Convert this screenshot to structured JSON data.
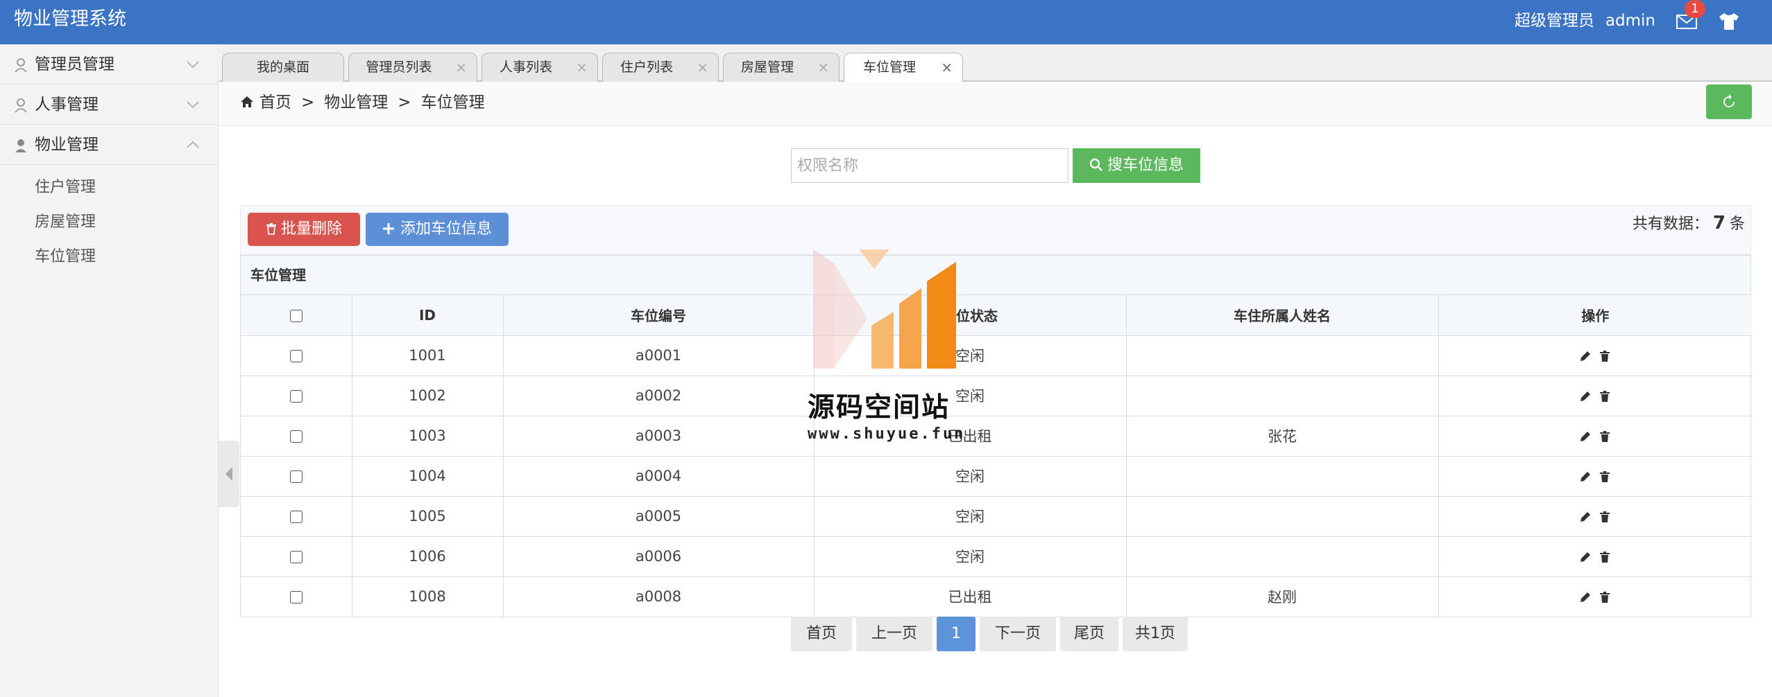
{
  "app": {
    "title": "物业管理系统"
  },
  "header": {
    "role": "超级管理员",
    "username": "admin",
    "mail_badge": "1"
  },
  "sidebar": {
    "groups": [
      {
        "label": "管理员管理",
        "expanded": false
      },
      {
        "label": "人事管理",
        "expanded": false
      },
      {
        "label": "物业管理",
        "expanded": true
      }
    ],
    "sub_items": [
      "住户管理",
      "房屋管理",
      "车位管理"
    ]
  },
  "tabs": [
    {
      "label": "我的桌面",
      "closable": false
    },
    {
      "label": "管理员列表",
      "closable": true
    },
    {
      "label": "人事列表",
      "closable": true
    },
    {
      "label": "住户列表",
      "closable": true
    },
    {
      "label": "房屋管理",
      "closable": true
    },
    {
      "label": "车位管理",
      "closable": true,
      "active": true
    }
  ],
  "breadcrumb": {
    "home": "首页",
    "level1": "物业管理",
    "level2": "车位管理",
    "separator": ">"
  },
  "search": {
    "placeholder": "权限名称",
    "value": "",
    "button_label": "搜车位信息"
  },
  "toolbar": {
    "delete_label": "批量删除",
    "add_label": "添加车位信息",
    "count_prefix": "共有数据：",
    "count_value": "7",
    "count_suffix": "条"
  },
  "table": {
    "panel_title": "车位管理",
    "columns": [
      "ID",
      "车位编号",
      "车位状态",
      "车住所属人姓名",
      "操作"
    ],
    "rows": [
      {
        "id": "1001",
        "code": "a0001",
        "status": "空闲",
        "owner": ""
      },
      {
        "id": "1002",
        "code": "a0002",
        "status": "空闲",
        "owner": ""
      },
      {
        "id": "1003",
        "code": "a0003",
        "status": "已出租",
        "owner": "张花"
      },
      {
        "id": "1004",
        "code": "a0004",
        "status": "空闲",
        "owner": ""
      },
      {
        "id": "1005",
        "code": "a0005",
        "status": "空闲",
        "owner": ""
      },
      {
        "id": "1006",
        "code": "a0006",
        "status": "空闲",
        "owner": ""
      },
      {
        "id": "1008",
        "code": "a0008",
        "status": "已出租",
        "owner": "赵刚"
      }
    ]
  },
  "pagination": {
    "first": "首页",
    "prev": "上一页",
    "current": "1",
    "next": "下一页",
    "last": "尾页",
    "total": "共1页"
  },
  "watermark": {
    "title": "源码空间站",
    "url": "www.shuyue.fun"
  },
  "colors": {
    "header": "#3b73c5",
    "success": "#5cb85c",
    "danger": "#d9534f",
    "primary": "#5c8fd6",
    "badge": "#e64a40"
  },
  "icons": {
    "mail": "mail-icon",
    "theme": "shirt-icon",
    "home": "home-icon",
    "refresh": "refresh-icon",
    "search": "search-icon",
    "trash": "trash-icon",
    "plus": "plus-icon",
    "edit": "pencil-icon",
    "user": "user-icon",
    "chevron": "chevron-icon",
    "collapse": "caret-left-icon"
  }
}
